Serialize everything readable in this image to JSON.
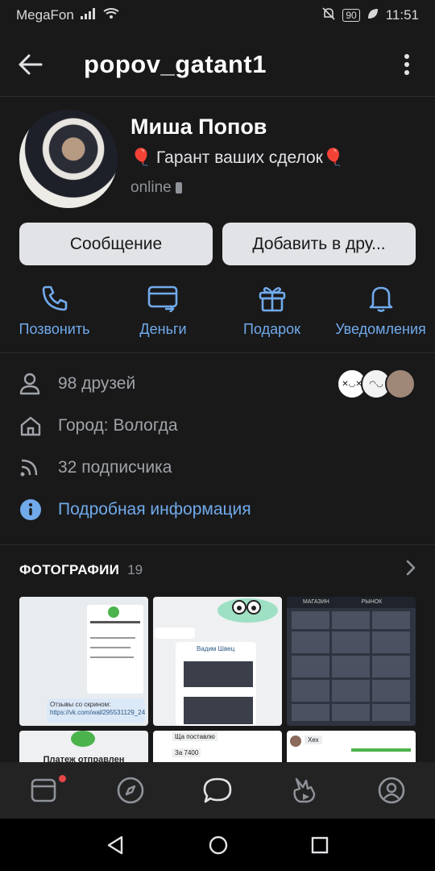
{
  "status_bar": {
    "carrier": "MegaFon",
    "battery": "90",
    "time": "11:51"
  },
  "header": {
    "username": "popov_gatant1"
  },
  "profile": {
    "name": "Миша Попов",
    "status_text": "🎈 Гарант ваших сделок🎈",
    "online": "online"
  },
  "buttons": {
    "message": "Сообщение",
    "add_friend": "Добавить в дру..."
  },
  "actions": [
    {
      "label": "Позвонить",
      "icon": "phone-icon"
    },
    {
      "label": "Деньги",
      "icon": "money-card-icon"
    },
    {
      "label": "Подарок",
      "icon": "gift-icon"
    },
    {
      "label": "Уведомления",
      "icon": "bell-icon"
    }
  ],
  "info": {
    "friends": "98 друзей",
    "city": "Город: Вологда",
    "followers": "32 подписчика",
    "details_link": "Подробная информация"
  },
  "photos": {
    "title": "ФОТОГРАФИИ",
    "count": "19",
    "photo1_text": "Платеж отправлен",
    "photo1_reviews": "Отзывы со скрином:",
    "photo1_link": "https://vk.com/wall295531129_24",
    "photo2_name": "Вадим Швец",
    "photo3_tab1": "МАГАЗИН",
    "photo3_tab2": "РЫНОК",
    "bottom1_text": "Платеж отправлен",
    "bottom2_line1": "Ща поставлю",
    "bottom2_line2": "За 7400",
    "bottom3_text": "Хех"
  },
  "colors": {
    "background": "#19191a",
    "accent": "#71aaeb",
    "button_bg": "#e1e3e6"
  }
}
